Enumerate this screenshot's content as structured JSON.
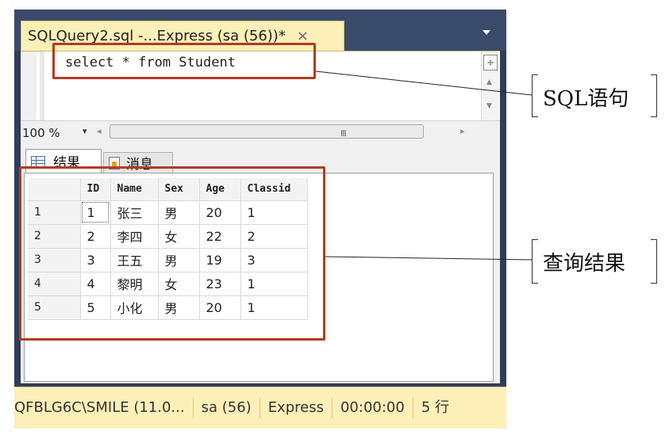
{
  "window": {
    "tab_title": "SQLQuery2.sql -...Express (sa (56))*",
    "tab_close": "×"
  },
  "editor": {
    "query": "select * from Student",
    "split_glyph": "÷"
  },
  "zoom": {
    "level": "100 %",
    "caret": "▾",
    "left_arrow": "◂",
    "right_arrow": "▸",
    "grip": "III"
  },
  "results_tabs": {
    "results": "结果",
    "messages": "消息"
  },
  "results_grid": {
    "columns": [
      "",
      "ID",
      "Name",
      "Sex",
      "Age",
      "Classid"
    ],
    "rows": [
      [
        "1",
        "1",
        "张三",
        "男",
        "20",
        "1"
      ],
      [
        "2",
        "2",
        "李四",
        "女",
        "22",
        "2"
      ],
      [
        "3",
        "3",
        "王五",
        "男",
        "19",
        "3"
      ],
      [
        "4",
        "4",
        "黎明",
        "女",
        "23",
        "1"
      ],
      [
        "5",
        "5",
        "小化",
        "男",
        "20",
        "1"
      ]
    ]
  },
  "statusbar": {
    "server": "QFBLG6C\\SMILE (11.0...",
    "user": "sa (56)",
    "edition": "Express",
    "elapsed": "00:00:00",
    "rows": "5 行"
  },
  "callouts": {
    "sql": "SQL语句",
    "result": "查询结果"
  },
  "colors": {
    "highlight": "#b33b22",
    "tab_background": "#fcefb7",
    "window_frame": "#2f3d57"
  }
}
